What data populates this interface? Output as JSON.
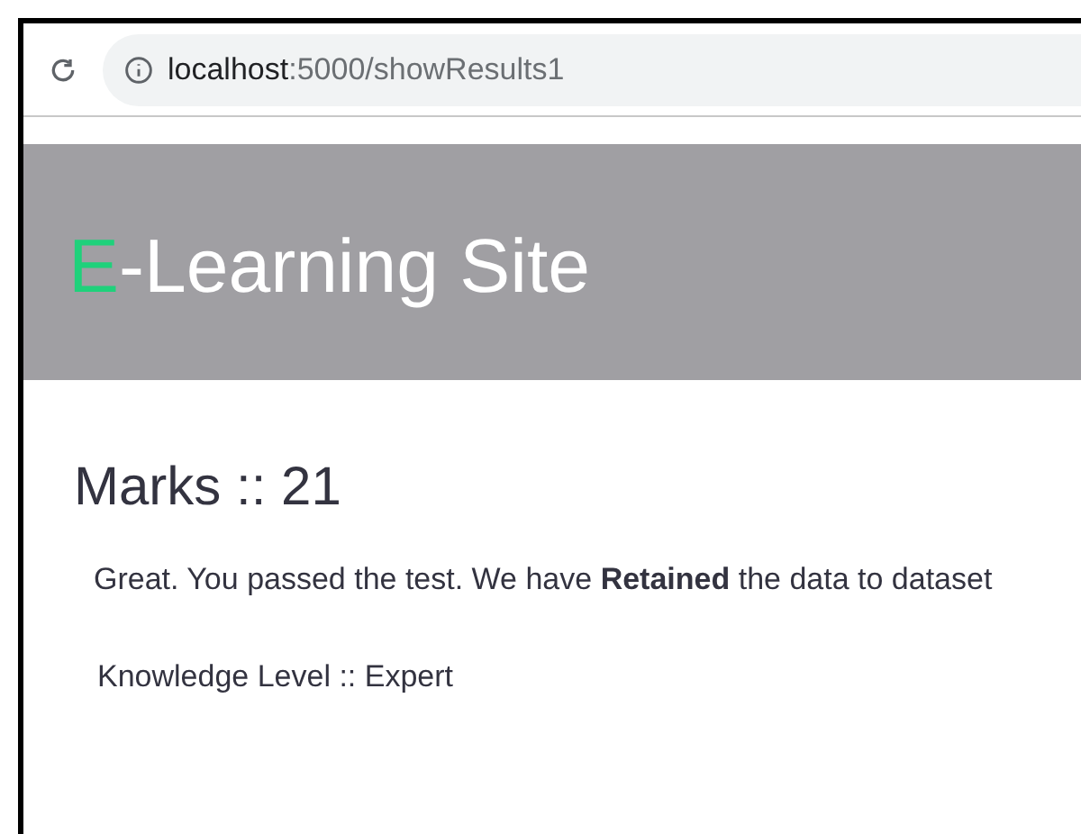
{
  "browser": {
    "url_host": "localhost",
    "url_path": ":5000/showResults1"
  },
  "header": {
    "logo_accent": "E",
    "logo_rest": "-Learning Site"
  },
  "results": {
    "marks": "Marks :: 21",
    "message": "Great. You passed the test. We have **Retained** the data to dataset",
    "knowledge": "Knowledge Level :: Expert"
  }
}
